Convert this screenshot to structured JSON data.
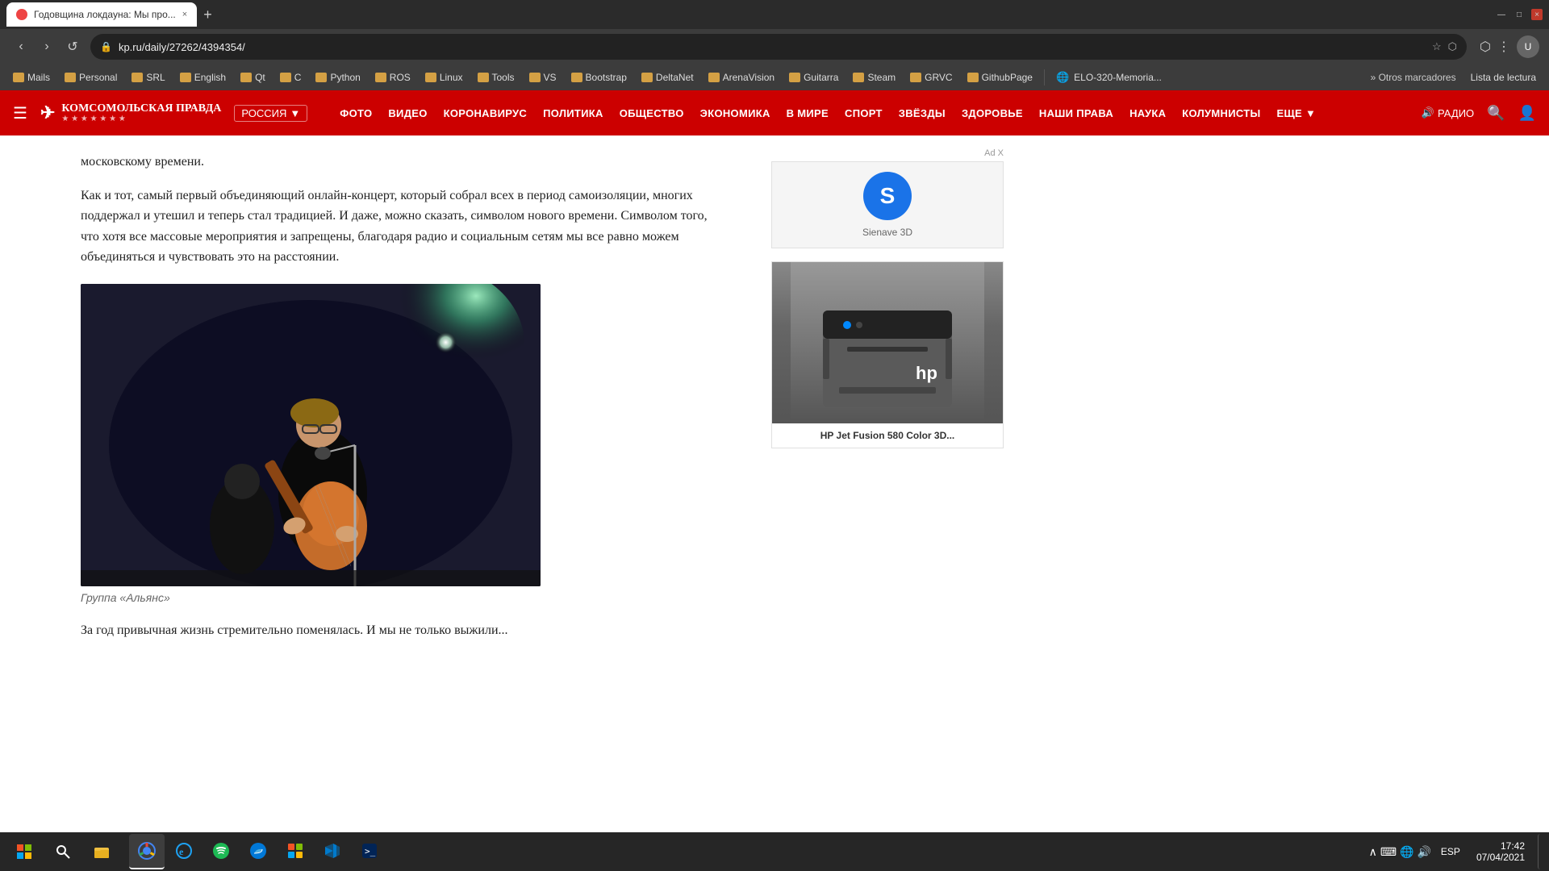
{
  "browser": {
    "tab": {
      "title": "Годовщина локдауна: Мы про...",
      "favicon_color": "#e44",
      "close_label": "×"
    },
    "new_tab_label": "+",
    "address": "kp.ru/daily/27262/4394354/",
    "lock_icon": "🔒",
    "window_controls": {
      "minimize": "—",
      "maximize": "□",
      "close": "×"
    }
  },
  "bookmarks": {
    "items": [
      {
        "label": "Mails",
        "type": "folder"
      },
      {
        "label": "Personal",
        "type": "folder"
      },
      {
        "label": "SRL",
        "type": "folder"
      },
      {
        "label": "English",
        "type": "folder"
      },
      {
        "label": "Qt",
        "type": "folder"
      },
      {
        "label": "C",
        "type": "folder"
      },
      {
        "label": "Python",
        "type": "folder"
      },
      {
        "label": "ROS",
        "type": "folder"
      },
      {
        "label": "Linux",
        "type": "folder"
      },
      {
        "label": "Tools",
        "type": "folder"
      },
      {
        "label": "VS",
        "type": "folder"
      },
      {
        "label": "Bootstrap",
        "type": "folder"
      },
      {
        "label": "DeltaNet",
        "type": "folder"
      },
      {
        "label": "ArenaVision",
        "type": "folder"
      },
      {
        "label": "Guitarra",
        "type": "folder"
      },
      {
        "label": "Steam",
        "type": "folder"
      },
      {
        "label": "GRVC",
        "type": "folder"
      },
      {
        "label": "GithubPage",
        "type": "folder"
      },
      {
        "label": "ELO-320-Memoria...",
        "type": "folder"
      }
    ],
    "more_label": "Otros marcadores",
    "reading_list": "Lista de lectura"
  },
  "site": {
    "logo_text": "КОМСОМОЛЬСКАЯ ПРАВДА",
    "logo_sub": "★",
    "russia_label": "РОССИЯ",
    "nav_items": [
      "ФОТО",
      "ВИДЕО",
      "КОРОНАВИРУС",
      "ПОЛИТИКА",
      "ОБЩЕСТВО",
      "ЭКОНОМИКА",
      "В МИРЕ",
      "СПОРТ",
      "ЗВЁЗДЫ",
      "ЗДОРОВЬЕ",
      "НАШИ ПРАВА",
      "НАУКА",
      "КОЛУМНИСТЫ",
      "ЕЩЕ"
    ],
    "radio_label": "РАДИО",
    "speaker_icon": "🔊"
  },
  "article": {
    "paragraph1": "московскому времени.",
    "paragraph2": "Как и тот, самый первый объединяющий онлайн-концерт, который собрал всех в период самоизоляции, многих поддержал и утешил и теперь стал традицией. И даже, можно сказать, символом нового времени. Символом того, что хотя все массовые мероприятия и запрещены, благодаря радио и социальным сетям мы все равно можем объединяться и чувствовать это на расстоянии.",
    "image_caption": "Группа «Альянс»",
    "paragraph3": "За год привычная жизнь стремительно поменялась. И мы не только выжили..."
  },
  "ad": {
    "close_label": "Ad X",
    "logo_letter": "S",
    "logo_bg": "#1a73e8",
    "label": "Sienave 3D",
    "product_title": "HP Jet Fusion 580 Color 3D..."
  },
  "taskbar": {
    "time": "17:42",
    "date": "07/04/2021",
    "lang": "ESP",
    "apps": [
      {
        "name": "start",
        "icon": "⊞"
      },
      {
        "name": "search",
        "icon": "🔍"
      },
      {
        "name": "file-explorer",
        "icon": "📁"
      },
      {
        "name": "chrome",
        "icon": "●"
      },
      {
        "name": "ie",
        "icon": "e"
      },
      {
        "name": "spotify",
        "icon": "♪"
      },
      {
        "name": "edge",
        "icon": "◉"
      },
      {
        "name": "apps",
        "icon": "⬛"
      },
      {
        "name": "visual-studio",
        "icon": "VS"
      },
      {
        "name": "terminal",
        "icon": ">_"
      }
    ],
    "tray": {
      "settings": "⚙",
      "minimize": "—",
      "desktop": "□"
    }
  }
}
